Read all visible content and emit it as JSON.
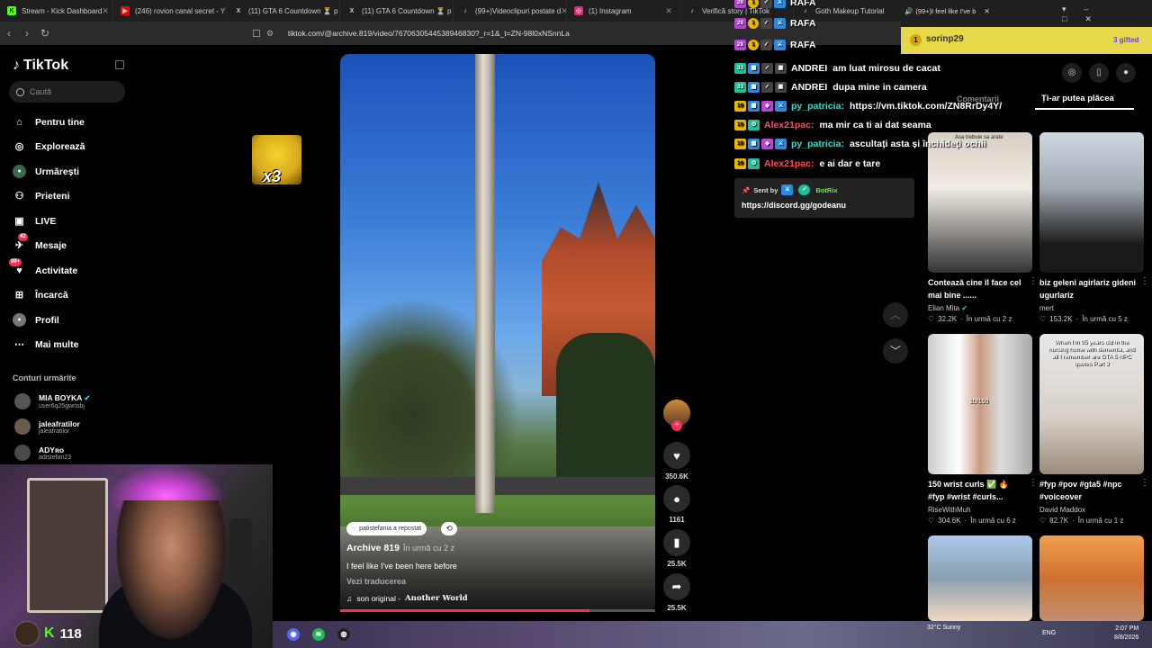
{
  "browser": {
    "tabs": [
      {
        "label": "Stream - Kick Dashboard",
        "icon": "K",
        "color": "#53fc18"
      },
      {
        "label": "(246) rovion canal secret - Y",
        "icon": "▶",
        "color": "#ff0000"
      },
      {
        "label": "(11) GTA 6 Countdown ⏳ p",
        "icon": "X",
        "color": "#000000"
      },
      {
        "label": "(11) GTA 6 Countdown ⏳ p",
        "icon": "X",
        "color": "#000000"
      },
      {
        "label": "(99+)Videoclipuri postate d",
        "icon": "♪",
        "color": "#000000"
      },
      {
        "label": "(1) Instagram",
        "icon": "◎",
        "color": "#d62976"
      },
      {
        "label": "Verifică story | TikTok",
        "icon": "♪",
        "color": "#000000"
      },
      {
        "label": "Goth Makeup Tutorial",
        "icon": "♪",
        "color": "#000000"
      }
    ],
    "active_tab": "(99+)I feel like I've b",
    "url": "tiktok.com/@archive.819/video/7670630544538946830?_r=1&_t=ZN-98l0xNSnnLa"
  },
  "sidebar": {
    "logo": "TikTok",
    "search_placeholder": "Caută",
    "nav": [
      {
        "label": "Pentru tine",
        "icon": "⌂",
        "badge": ""
      },
      {
        "label": "Explorează",
        "icon": "◎",
        "badge": ""
      },
      {
        "label": "Urmărești",
        "icon": "●",
        "badge": ""
      },
      {
        "label": "Prieteni",
        "icon": "⚇",
        "badge": ""
      },
      {
        "label": "LIVE",
        "icon": "▣",
        "badge": ""
      },
      {
        "label": "Mesaje",
        "icon": "✈",
        "badge": "42"
      },
      {
        "label": "Activitate",
        "icon": "♥",
        "badge": "99+"
      },
      {
        "label": "Încarcă",
        "icon": "⊞",
        "badge": ""
      },
      {
        "label": "Profil",
        "icon": "●",
        "badge": ""
      },
      {
        "label": "Mai multe",
        "icon": "⋯",
        "badge": ""
      }
    ],
    "following_title": "Conturi urmărite",
    "accounts": [
      {
        "name": "MIA BOYKA",
        "handle": "user6q25gwnsbj",
        "verified": true
      },
      {
        "name": "jaleafratilor",
        "handle": "jaleafratilor",
        "verified": false
      },
      {
        "name": "ADYʀᴏ",
        "handle": "adistefan23",
        "verified": false
      }
    ]
  },
  "overlay": {
    "reaction_label": "x3",
    "kick_count": "118",
    "kick_logo": "K"
  },
  "video": {
    "repost_chip": "patistefania a repostat",
    "author": "Archive 819",
    "when": "În urmă cu 2 z",
    "description": "I feel like I've been here before",
    "translate": "Vezi traducerea",
    "sound_prefix": "son original -",
    "sound_title": "Another World",
    "progress": 0.79
  },
  "actions": {
    "likes": "350.6K",
    "comments": "1161",
    "saves": "25.5K",
    "shares": "25.5K"
  },
  "chat": {
    "lines": [
      {
        "lvl": "28",
        "name": "RAFA",
        "msg": "",
        "color": "#ffffff"
      },
      {
        "lvl": "28",
        "name": "RAFA",
        "msg": "",
        "color": "#ffffff"
      },
      {
        "lvl": "28",
        "name": "RAFA",
        "msg": "",
        "color": "#ffffff"
      },
      {
        "lvl": "33",
        "name": "ANDREI",
        "msg": "am luat mirosu de cacat",
        "color": "#ffffff"
      },
      {
        "lvl": "33",
        "name": "ANDREI",
        "msg": "dupa mine in camera",
        "color": "#ffffff"
      },
      {
        "lvl": "19",
        "name": "py_patricia:",
        "msg": "https://vm.tiktok.com/ZN8RrDy4Y/",
        "color": "#3ed8c8"
      },
      {
        "lvl": "19",
        "name": "Alex21pac:",
        "msg": "ma mir ca ti ai dat seama",
        "color": "#ff4b5a"
      },
      {
        "lvl": "19",
        "name": "py_patricia:",
        "msg": "ascultați asta și închideți ochii",
        "color": "#3ed8c8"
      },
      {
        "lvl": "19",
        "name": "Alex21pac:",
        "msg": "e ai dar e tare",
        "color": "#ff4b5a"
      }
    ],
    "bot": {
      "sent_by": "Sent by",
      "bot_name": "BotRix",
      "link": "https://discord.gg/godeanu"
    }
  },
  "right_panel": {
    "gift_user": "sorinp29",
    "gift_count": "1",
    "gifted_label": "3 gifted",
    "tab_comments": "Comentarii",
    "tab_like": "Ți-ar putea plăcea",
    "cards": [
      {
        "title": "Contează cine îl face cel mai bine ......",
        "author": "Elian Mita",
        "likes": "32.2K",
        "when": "În urmă cu 2 z",
        "caption": "Asa trebuie sa arate"
      },
      {
        "title": "biz geleni agirlariz gideni ugurlariz",
        "author": "mert",
        "likes": "153.2K",
        "when": "În urmă cu 5 z",
        "caption": ""
      },
      {
        "title": "150 wrist curls ✅ 🔥 #fyp #wrist #curls...",
        "author": "RiseWithMuh",
        "likes": "304.6K",
        "when": "În urmă cu 6 z",
        "caption": "10/150"
      },
      {
        "title": "#fyp #pov #gta5 #npc #voiceover",
        "author": "David Maddox",
        "likes": "82.7K",
        "when": "În urmă cu 1 z",
        "caption": "When I'm 95 years old in the nursing home with dementia, and all I remember are GTA 5 NPC quotes Part 3"
      },
      {
        "title": "",
        "author": "",
        "likes": "",
        "when": "",
        "caption": ""
      },
      {
        "title": "",
        "author": "",
        "likes": "",
        "when": "",
        "caption": ""
      }
    ]
  },
  "taskbar": {
    "weather": "32°C Sunny",
    "lang": "ENG",
    "time": "2:07 PM",
    "date": "8/8/2026"
  }
}
